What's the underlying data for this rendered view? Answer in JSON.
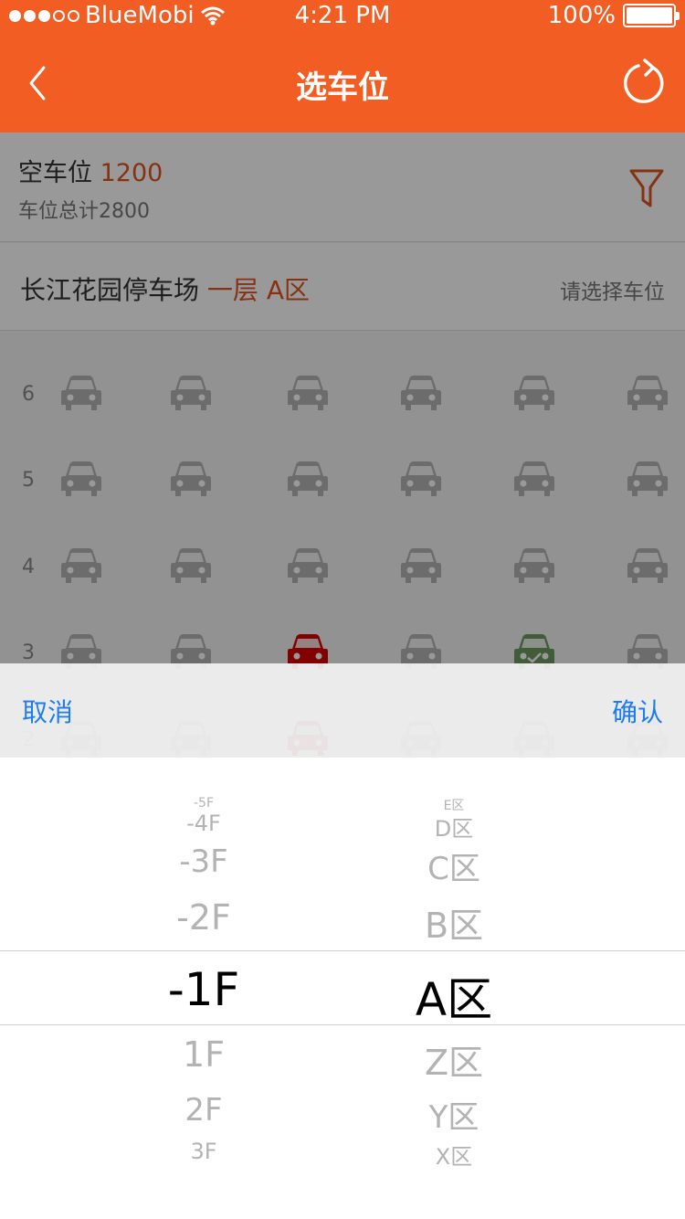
{
  "status_bar": {
    "carrier": "BlueMobi",
    "time": "4:21 PM",
    "battery": "100%"
  },
  "nav": {
    "title": "选车位"
  },
  "stats": {
    "empty_label": "空车位",
    "empty_count": "1200",
    "total_text": "车位总计2800"
  },
  "location": {
    "lot_name": "长江花园停车场",
    "area": "一层 A区",
    "hint": "请选择车位"
  },
  "grid": {
    "rows": [
      {
        "label": "6",
        "cars": [
          "gray",
          "gray",
          "gray",
          "gray",
          "gray",
          "gray"
        ]
      },
      {
        "label": "5",
        "cars": [
          "gray",
          "gray",
          "gray",
          "gray",
          "gray",
          "gray"
        ]
      },
      {
        "label": "4",
        "cars": [
          "gray",
          "gray",
          "gray",
          "gray",
          "gray",
          "gray"
        ]
      },
      {
        "label": "3",
        "cars": [
          "gray",
          "gray",
          "red",
          "gray",
          "green",
          "gray"
        ]
      },
      {
        "label": "2",
        "cars": [
          "gray",
          "gray",
          "red",
          "gray",
          "gray",
          "gray"
        ]
      }
    ]
  },
  "colors": {
    "accent": "#f15d22",
    "highlight": "#e0541f",
    "car_gray": "#b5b5b5",
    "car_red": "#d80000",
    "car_green": "#6f9a5f",
    "link_blue": "#1c7cf0"
  },
  "picker": {
    "cancel": "取消",
    "confirm": "确认",
    "floors": [
      "-5F",
      "-4F",
      "-3F",
      "-2F",
      "-1F",
      "1F",
      "2F",
      "3F"
    ],
    "areas": [
      "E区",
      "D区",
      "C区",
      "B区",
      "A区",
      "Z区",
      "Y区",
      "X区"
    ],
    "selected_floor": "-1F",
    "selected_area": "A区"
  }
}
